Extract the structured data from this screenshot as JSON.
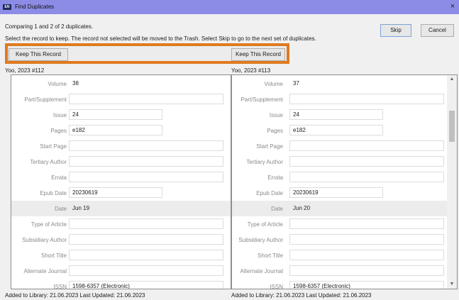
{
  "window": {
    "app_icon": "EN",
    "title": "Find Duplicates",
    "close": "×"
  },
  "info": {
    "comparing": "Comparing 1 and 2 of 2 duplicates.",
    "instruction": "Select the record to keep. The record not selected will be moved to the Trash. Select Skip to go to the next set of duplicates."
  },
  "buttons": {
    "skip": "Skip",
    "cancel": "Cancel",
    "keep": "Keep This Record"
  },
  "left": {
    "title": "Yoo, 2023 #112",
    "rows": [
      {
        "label": "Volume",
        "value": "38"
      },
      {
        "label": "Part/Supplement",
        "value": ""
      },
      {
        "label": "Issue",
        "value": "24"
      },
      {
        "label": "Pages",
        "value": "e182"
      },
      {
        "label": "Start Page",
        "value": ""
      },
      {
        "label": "Tertiary Author",
        "value": ""
      },
      {
        "label": "Errata",
        "value": ""
      },
      {
        "label": "Epub Date",
        "value": "20230619"
      },
      {
        "label": "Date",
        "value": "Jun 19"
      },
      {
        "label": "Type of Article",
        "value": ""
      },
      {
        "label": "Subsidiary Author",
        "value": ""
      },
      {
        "label": "Short Title",
        "value": ""
      },
      {
        "label": "Alternate Journal",
        "value": ""
      },
      {
        "label": "ISSN",
        "value": "1598-6357 (Electronic)"
      }
    ],
    "footer": "Added to Library: 21.06.2023    Last Updated: 21.06.2023"
  },
  "right": {
    "title": "Yoo, 2023 #113",
    "rows": [
      {
        "label": "Volume",
        "value": "37"
      },
      {
        "label": "Part/Supplement",
        "value": ""
      },
      {
        "label": "Issue",
        "value": "24"
      },
      {
        "label": "Pages",
        "value": "e182"
      },
      {
        "label": "Start Page",
        "value": ""
      },
      {
        "label": "Tertiary Author",
        "value": ""
      },
      {
        "label": "Errata",
        "value": ""
      },
      {
        "label": "Epub Date",
        "value": "20230619"
      },
      {
        "label": "Date",
        "value": "Jun 20"
      },
      {
        "label": "Type of Article",
        "value": ""
      },
      {
        "label": "Subsidiary Author",
        "value": ""
      },
      {
        "label": "Short Title",
        "value": ""
      },
      {
        "label": "Alternate Journal",
        "value": ""
      },
      {
        "label": "ISSN",
        "value": "1598-6357 (Electronic)"
      }
    ],
    "footer": "Added to Library: 21.06.2023    Last Updated: 21.06.2023"
  },
  "scroll": {
    "up": "▲",
    "down": "▼"
  }
}
